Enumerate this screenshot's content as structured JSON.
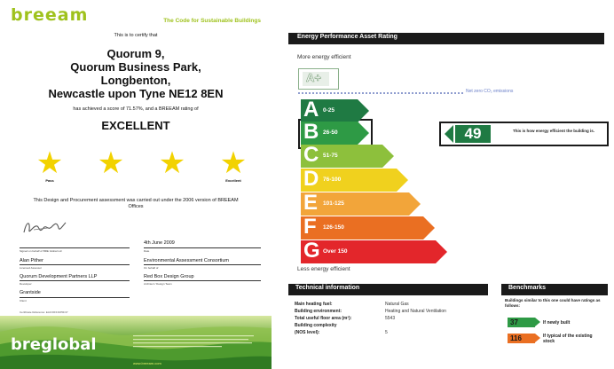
{
  "certificate": {
    "logo": "breeam",
    "tagline": "The Code for Sustainable Buildings",
    "certify_text": "This is to certify that",
    "address_lines": [
      "Quorum 9,",
      "Quorum Business Park,",
      "Longbenton,",
      "Newcastle upon Tyne NE12 8EN"
    ],
    "score_text": "has achieved a score of 71.57%, and a BREEAM rating of",
    "rating": "EXCELLENT",
    "stars": 4,
    "star_labels": {
      "left": "Pass",
      "right": "Excellent"
    },
    "design_text": "This Design and Procurement assessment was carried out under the 2006 version of BREEAM Offices",
    "signed_on_behalf": "Signed on behalf of BRE Global Ltd",
    "date_value": "4th June 2009",
    "date_label": "Date",
    "assessor_name": "Alan Pither",
    "assessor_label": "Licensed Assessor",
    "assessor_org": "Environmental Assessment Consortium",
    "assessor_org_label": "On behalf of",
    "developer_name": "Quorum Development Partners LLP",
    "developer_label": "Developer",
    "architect_name": "Red Box Design Group",
    "architect_label": "Architect / Design Team",
    "client_name": "Grantside",
    "client_label": "Client",
    "cert_ref": "Certificate Reference: EAC/OFF/4/PR/47",
    "footer_logo": "breglobal",
    "footer_url": "www.breeam.com"
  },
  "epc": {
    "title": "Energy Performance Asset Rating",
    "more_efficient": "More energy efficient",
    "less_efficient": "Less energy efficient",
    "a_plus": "A+",
    "net_zero": "Net zero CO₂ emissions",
    "bands": [
      {
        "letter": "A",
        "range": "0-25",
        "color": "#1f7a43"
      },
      {
        "letter": "B",
        "range": "26-50",
        "color": "#2e9a45"
      },
      {
        "letter": "C",
        "range": "51-75",
        "color": "#8dc03c"
      },
      {
        "letter": "D",
        "range": "76-100",
        "color": "#f0d11e"
      },
      {
        "letter": "E",
        "range": "101-125",
        "color": "#f2a53a"
      },
      {
        "letter": "F",
        "range": "126-150",
        "color": "#ea6f22"
      },
      {
        "letter": "G",
        "range": "Over 150",
        "color": "#e3262b"
      }
    ],
    "current_rating": "49",
    "current_band": "B",
    "current_text": "This is how energy efficient the building is.",
    "technical_title": "Technical information",
    "technical_rows": [
      {
        "label": "Main heating fuel:",
        "value": "Natural Gas"
      },
      {
        "label": "Building environment:",
        "value": "Heating and Natural Ventilation"
      },
      {
        "label": "Total useful floor area (m²):",
        "value": "5543"
      },
      {
        "label": "Building complexity",
        "value": ""
      },
      {
        "label": "(NOS level):",
        "value": "5"
      }
    ],
    "benchmarks_title": "Benchmarks",
    "benchmarks_intro": "Buildings similar to this one could have ratings as follows:",
    "benchmarks": [
      {
        "value": "37",
        "label": "If newly built",
        "color": "#2e9a45"
      },
      {
        "value": "116",
        "label": "If typical of the existing stock",
        "color": "#ea6f22"
      }
    ]
  }
}
